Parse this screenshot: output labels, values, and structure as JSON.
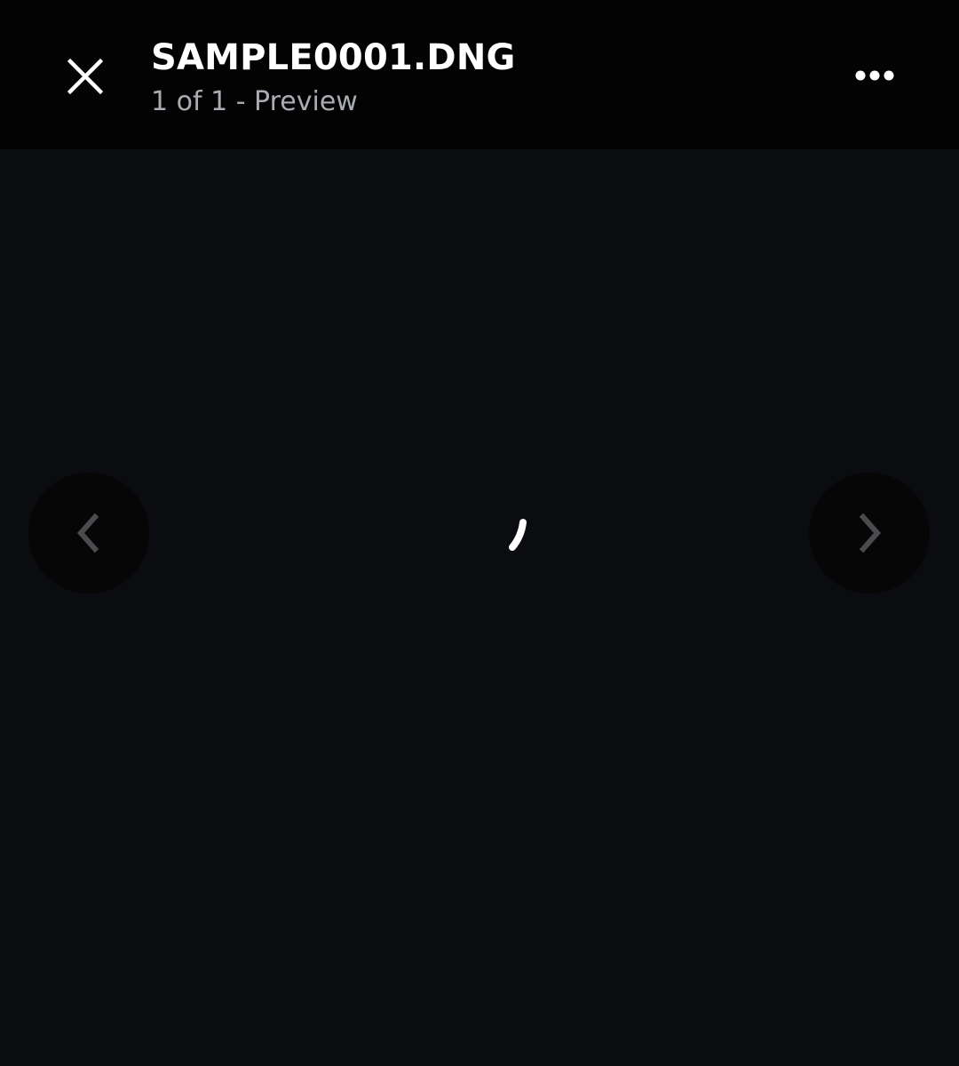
{
  "header": {
    "title": "SAMPLE0001.DNG",
    "subtitle": "1 of 1 - Preview",
    "close_icon": "close-icon",
    "more_icon": "more-horizontal-icon"
  },
  "viewer": {
    "state": "loading",
    "prev_icon": "chevron-left-icon",
    "next_icon": "chevron-right-icon",
    "spinner_icon": "loading-spinner-icon"
  },
  "colors": {
    "header_bg": "#030304",
    "viewer_bg": "#0b0c0f",
    "nav_button_bg": "#060607",
    "chevron": "#4a4b4f",
    "title": "#ffffff",
    "subtitle": "#a9acb2"
  }
}
